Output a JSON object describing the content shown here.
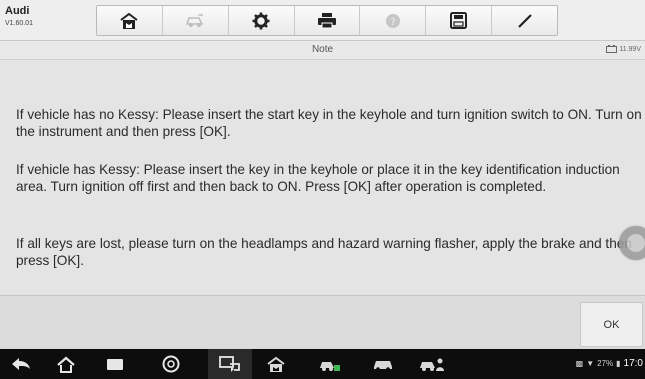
{
  "vehicle": {
    "make": "Audi",
    "version": "V1.60.01"
  },
  "toolbar": {
    "buttons": [
      {
        "icon": "home-icon",
        "enabled": true
      },
      {
        "icon": "vehicle-swap-icon",
        "enabled": false
      },
      {
        "icon": "settings-gear-icon",
        "enabled": true
      },
      {
        "icon": "print-icon",
        "enabled": true
      },
      {
        "icon": "help-icon",
        "enabled": false
      },
      {
        "icon": "save-icon",
        "enabled": true
      },
      {
        "icon": "pen-icon",
        "enabled": true
      }
    ]
  },
  "header": {
    "title": "Note",
    "battery_voltage": "11.99V"
  },
  "note": {
    "p1": "If vehicle has no Kessy:  Please insert the start key in the keyhole and turn ignition switch to ON. Turn on the instrument and then press [OK].",
    "p2": "If vehicle has Kessy:  Please insert the key in the keyhole or place it in the key identification induction area. Turn ignition off first and then back to ON. Press [OK] after operation is completed.",
    "p3": "If all keys are lost, please turn on the headlamps and hazard warning flasher, apply the brake and then press [OK]."
  },
  "footer": {
    "ok_label": "OK"
  },
  "statusbar": {
    "battery_percent": "27%",
    "time": "17:0"
  },
  "colors": {
    "toolbar_bg": "#eeeeee",
    "content_bg": "#e4e4e4",
    "navbar_bg": "#0d0d0d"
  }
}
